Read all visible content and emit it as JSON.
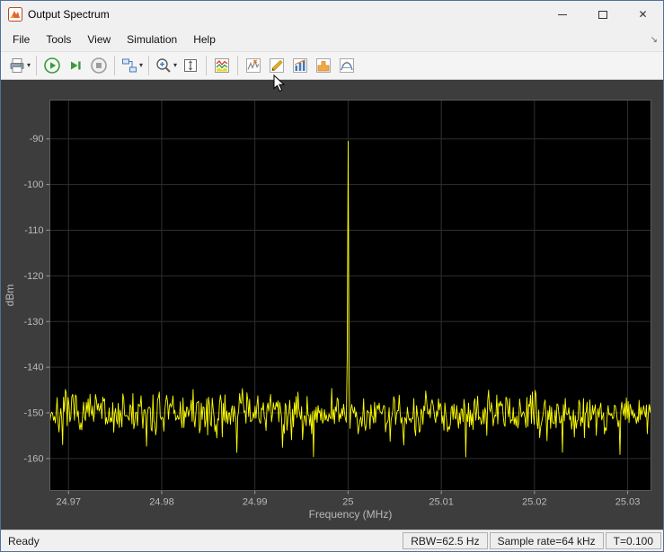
{
  "window": {
    "title": "Output Spectrum"
  },
  "icons": {
    "close": "✕",
    "caret_down": "▾",
    "collapse_arrow": "↘"
  },
  "menu": {
    "items": [
      {
        "label": "File"
      },
      {
        "label": "Tools"
      },
      {
        "label": "View"
      },
      {
        "label": "Simulation"
      },
      {
        "label": "Help"
      }
    ]
  },
  "toolbar": {
    "buttons": [
      "print",
      "run",
      "step-forward",
      "stop",
      "simulation-settings",
      "zoom-in",
      "span-x-axis",
      "spectrum-settings",
      "peak-finder",
      "cursor-measurements",
      "signal-statistics",
      "spectral-mask",
      "distortion-measurements"
    ]
  },
  "statusbar": {
    "left": "Ready",
    "segments": [
      {
        "text": "RBW=62.5 Hz"
      },
      {
        "text": "Sample rate=64 kHz"
      },
      {
        "text": "T=0.100"
      }
    ]
  },
  "chart_data": {
    "type": "line",
    "title": "",
    "xlabel": "Frequency (MHz)",
    "ylabel": "dBm",
    "xlim": [
      24.968,
      25.0325
    ],
    "ylim": [
      -167,
      -81.5
    ],
    "x_ticks": [
      24.97,
      24.98,
      24.99,
      25,
      25.01,
      25.02,
      25.03
    ],
    "x_tick_labels": [
      "24.97",
      "24.98",
      "24.99",
      "25",
      "25.01",
      "25.02",
      "25.03"
    ],
    "y_ticks": [
      -90,
      -100,
      -110,
      -120,
      -130,
      -140,
      -150,
      -160
    ],
    "grid": true,
    "legend": "none",
    "plot_bg": "#000000",
    "outer_bg": "#3d3d3d",
    "grid_color": "#2f2f2f",
    "axis_color": "#5a5a5a",
    "tick_color": "#9a9a9a",
    "label_color": "#b9b9b9",
    "series": [
      {
        "name": "Output Spectrum",
        "color": "#ffff00",
        "noise_floor_dbm": -150,
        "noise_peak_to_peak_db": 13,
        "occasional_dip_min_dbm": -164,
        "peak": {
          "freq_mhz": 25,
          "level_dbm": -90.5
        },
        "points": 660,
        "seed": 7
      }
    ]
  }
}
